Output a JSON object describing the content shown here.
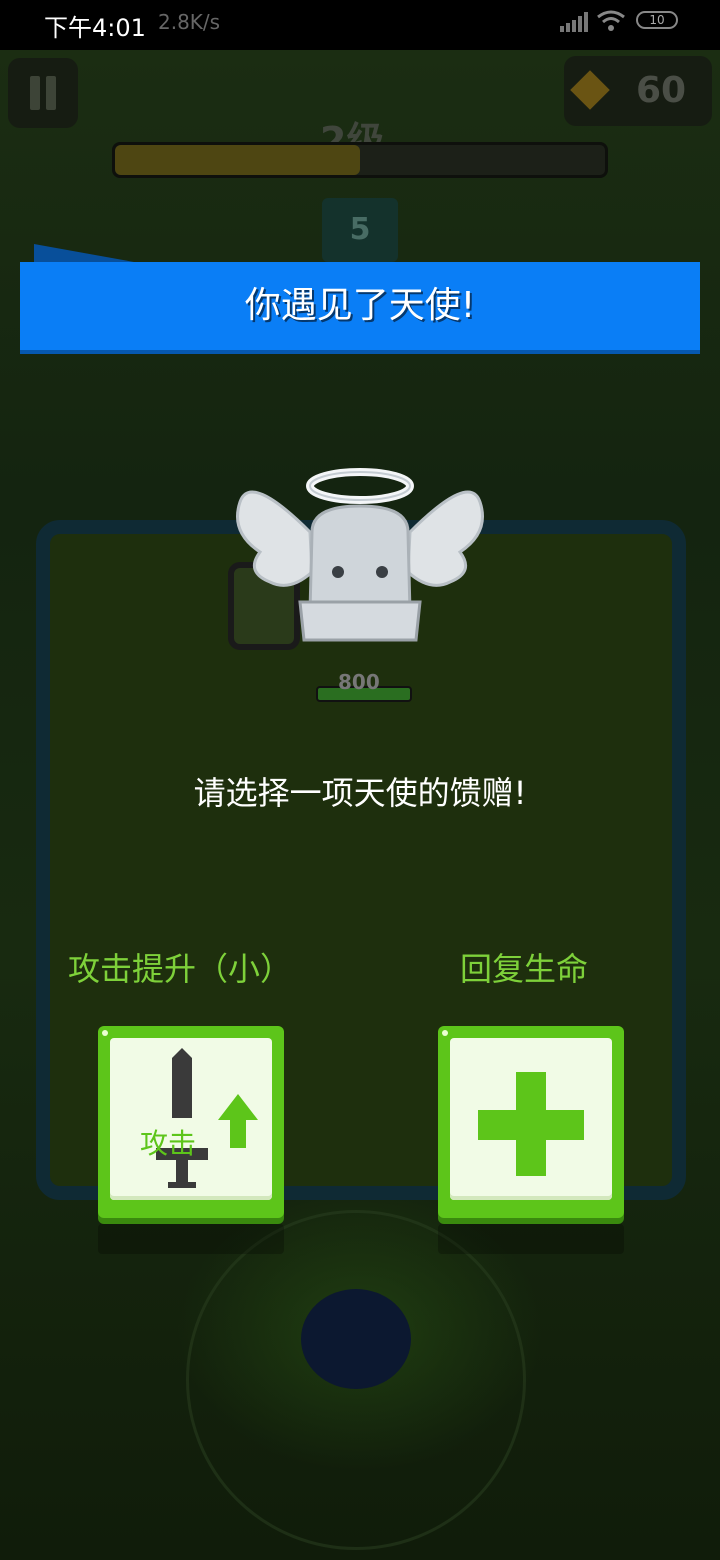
{
  "status_bar": {
    "time": "下午4:01",
    "network_speed": "2.8K/s",
    "battery": "10",
    "icons": [
      "signal-icon",
      "wifi-icon",
      "battery-icon"
    ]
  },
  "hud": {
    "level_label": "2级",
    "level_progress": 0.5,
    "gems": "60",
    "enemy_count": "5",
    "boss_hp": "800"
  },
  "dialog": {
    "title": "你遇见了天使!",
    "prompt": "请选择一项天使的馈赠!",
    "choices": [
      {
        "label": "攻击提升（小）",
        "icon": "attack-up-icon",
        "icon_text": "攻击"
      },
      {
        "label": "回复生命",
        "icon": "heal-plus-icon"
      }
    ]
  },
  "colors": {
    "banner": "#0a7ef6",
    "choice_text": "#7ed13a",
    "card_border": "#5dc51a",
    "card_face": "#f1fbe6"
  }
}
